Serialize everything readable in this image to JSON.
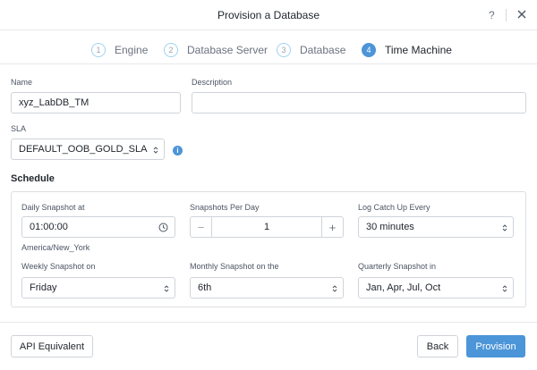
{
  "dialog": {
    "title": "Provision a Database",
    "help_glyph": "?"
  },
  "steps": [
    {
      "num": "1",
      "label": "Engine"
    },
    {
      "num": "2",
      "label": "Database Server"
    },
    {
      "num": "3",
      "label": "Database"
    },
    {
      "num": "4",
      "label": "Time Machine"
    }
  ],
  "form": {
    "name_label": "Name",
    "name_value": "xyz_LabDB_TM",
    "description_label": "Description",
    "description_value": "",
    "sla_label": "SLA",
    "sla_value": "DEFAULT_OOB_GOLD_SLA",
    "info_glyph": "i"
  },
  "schedule": {
    "title": "Schedule",
    "daily_label": "Daily Snapshot at",
    "daily_value": "01:00:00",
    "timezone": "America/New_York",
    "per_day_label": "Snapshots Per Day",
    "per_day_value": "1",
    "minus_glyph": "−",
    "plus_glyph": "+",
    "log_label": "Log Catch Up Every",
    "log_value": "30 minutes",
    "weekly_label": "Weekly Snapshot on",
    "weekly_value": "Friday",
    "monthly_label": "Monthly Snapshot on the",
    "monthly_value": "6th",
    "quarterly_label": "Quarterly Snapshot in",
    "quarterly_value": "Jan, Apr, Jul, Oct"
  },
  "footer": {
    "api_label": "API Equivalent",
    "back_label": "Back",
    "provision_label": "Provision"
  },
  "colors": {
    "accent": "#4c95d8",
    "border": "#cfd4da"
  }
}
